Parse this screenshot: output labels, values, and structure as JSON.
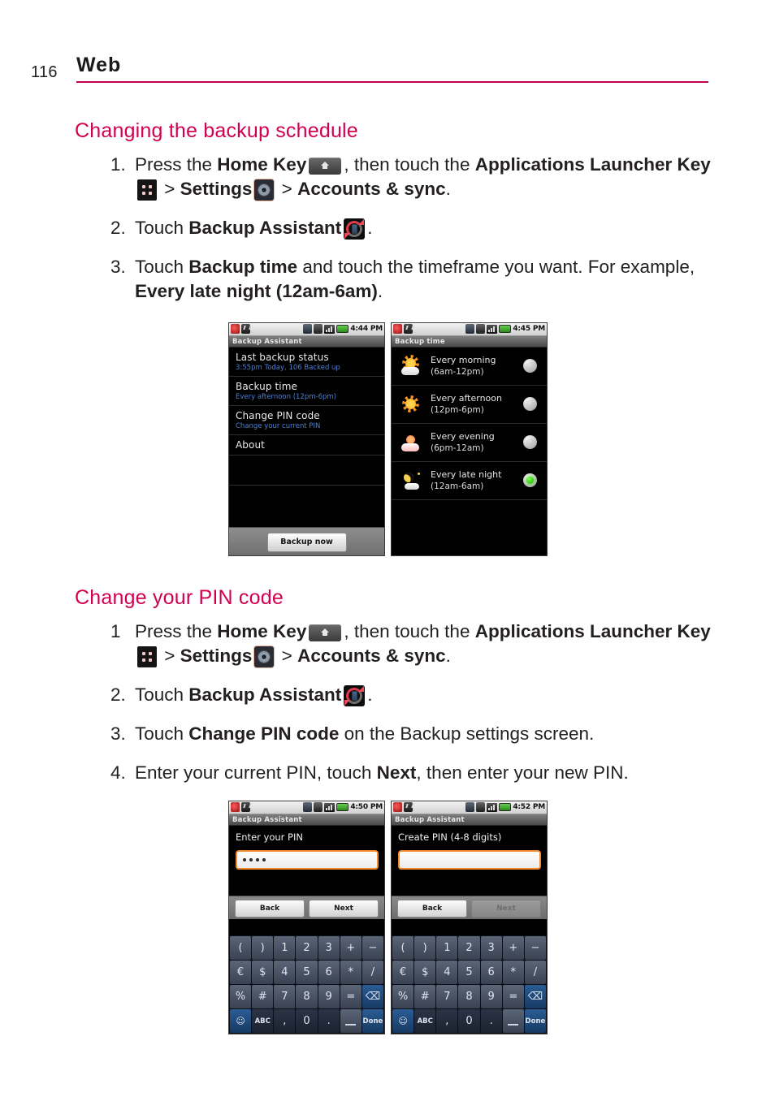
{
  "header": {
    "page_number": "116",
    "chapter": "Web",
    "rule_color": "#c3004f"
  },
  "sections": [
    {
      "heading": "Changing the backup schedule",
      "heading_color": "#d2004e",
      "steps": [
        {
          "number": "1.",
          "parts": [
            {
              "type": "text",
              "text": "Press the "
            },
            {
              "type": "bold",
              "text": "Home Key"
            },
            {
              "type": "icon",
              "name": "home-key-icon"
            },
            {
              "type": "text",
              "text": ", then touch the "
            },
            {
              "type": "bold",
              "text": "Applications Launcher Key"
            },
            {
              "type": "icon",
              "name": "applications-launcher-key-icon"
            },
            {
              "type": "text",
              "text": " > "
            },
            {
              "type": "bold",
              "text": "Settings"
            },
            {
              "type": "icon",
              "name": "settings-icon"
            },
            {
              "type": "text",
              "text": " > "
            },
            {
              "type": "bold",
              "text": "Accounts & sync"
            },
            {
              "type": "text",
              "text": "."
            }
          ]
        },
        {
          "number": "2.",
          "parts": [
            {
              "type": "text",
              "text": "Touch "
            },
            {
              "type": "bold",
              "text": "Backup Assistant"
            },
            {
              "type": "icon",
              "name": "backup-assistant-icon"
            },
            {
              "type": "text",
              "text": "."
            }
          ]
        },
        {
          "number": "3.",
          "parts": [
            {
              "type": "text",
              "text": "Touch "
            },
            {
              "type": "bold",
              "text": "Backup time"
            },
            {
              "type": "text",
              "text": " and touch the timeframe you want. For example, "
            },
            {
              "type": "bold",
              "text": "Every late night (12am-6am)"
            },
            {
              "type": "text",
              "text": "."
            }
          ]
        }
      ]
    },
    {
      "heading": "Change your PIN code",
      "heading_color": "#d2004e",
      "steps": [
        {
          "number": "1",
          "parts": [
            {
              "type": "text",
              "text": "Press the "
            },
            {
              "type": "bold",
              "text": "Home Key"
            },
            {
              "type": "icon",
              "name": "home-key-icon"
            },
            {
              "type": "text",
              "text": ", then touch the "
            },
            {
              "type": "bold",
              "text": "Applications Launcher Key"
            },
            {
              "type": "icon",
              "name": "applications-launcher-key-icon"
            },
            {
              "type": "text",
              "text": " > "
            },
            {
              "type": "bold",
              "text": "Settings"
            },
            {
              "type": "icon",
              "name": "settings-icon"
            },
            {
              "type": "text",
              "text": " > "
            },
            {
              "type": "bold",
              "text": "Accounts & sync"
            },
            {
              "type": "text",
              "text": "."
            }
          ]
        },
        {
          "number": "2.",
          "parts": [
            {
              "type": "text",
              "text": "Touch "
            },
            {
              "type": "bold",
              "text": "Backup Assistant"
            },
            {
              "type": "icon",
              "name": "backup-assistant-icon"
            },
            {
              "type": "text",
              "text": "."
            }
          ]
        },
        {
          "number": "3.",
          "parts": [
            {
              "type": "text",
              "text": "Touch "
            },
            {
              "type": "bold",
              "text": "Change PIN code"
            },
            {
              "type": "text",
              "text": " on the Backup settings screen."
            }
          ]
        },
        {
          "number": "4.",
          "parts": [
            {
              "type": "text",
              "text": "Enter your current PIN, touch "
            },
            {
              "type": "bold",
              "text": "Next"
            },
            {
              "type": "text",
              "text": ", then enter your new PIN."
            }
          ]
        }
      ]
    }
  ],
  "screenshots": {
    "backup_assistant": {
      "status_time": "4:44 PM",
      "title": "Backup Assistant",
      "rows": [
        {
          "title": "Last backup status",
          "subtitle": "3:55pm Today, 106 Backed up"
        },
        {
          "title": "Backup time",
          "subtitle": "Every afternoon (12pm-6pm)"
        },
        {
          "title": "Change PIN code",
          "subtitle": "Change your current PIN"
        },
        {
          "title": "About",
          "subtitle": ""
        }
      ],
      "button": "Backup now"
    },
    "backup_time": {
      "status_time": "4:45 PM",
      "title": "Backup time",
      "options": [
        {
          "label": "Every morning",
          "range": "(6am-12pm)",
          "icon": "sun-behind-cloud-icon",
          "selected": false
        },
        {
          "label": "Every afternoon",
          "range": "(12pm-6pm)",
          "icon": "sun-icon",
          "selected": false
        },
        {
          "label": "Every evening",
          "range": "(6pm-12am)",
          "icon": "sunset-cloud-icon",
          "selected": false
        },
        {
          "label": "Every late night",
          "range": "(12am-6am)",
          "icon": "moon-cloud-icon",
          "selected": true
        }
      ]
    },
    "enter_pin": {
      "status_time": "4:50 PM",
      "title": "Backup Assistant",
      "prompt": "Enter your PIN",
      "field_value": "••••",
      "back_label": "Back",
      "next_label": "Next",
      "next_disabled": false
    },
    "create_pin": {
      "status_time": "4:52 PM",
      "title": "Backup Assistant",
      "prompt": "Create PIN (4-8 digits)",
      "field_value": "",
      "back_label": "Back",
      "next_label": "Next",
      "next_disabled": true
    },
    "keypad": {
      "rows": [
        [
          "(",
          ")",
          "1",
          "2",
          "3",
          "+",
          "−"
        ],
        [
          "€",
          "$",
          "4",
          "5",
          "6",
          "*",
          "/"
        ],
        [
          "%",
          "#",
          "7",
          "8",
          "9",
          "=",
          "⌫"
        ],
        [
          "IM",
          "ABC",
          ",",
          "0",
          ".",
          "_",
          "Done"
        ]
      ]
    }
  }
}
